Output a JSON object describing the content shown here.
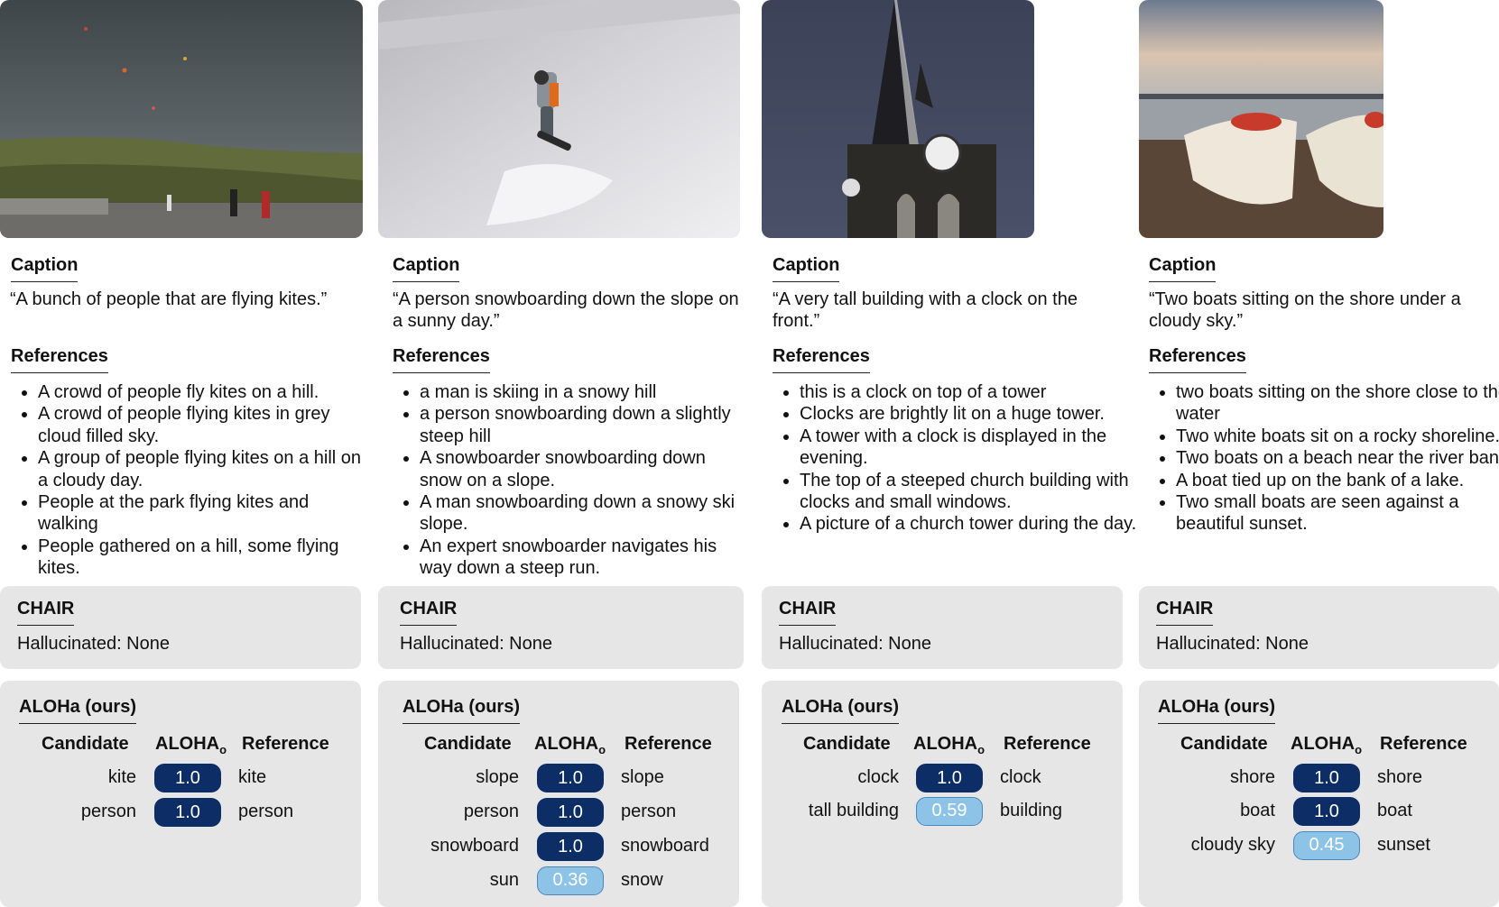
{
  "labels": {
    "caption": "Caption",
    "references": "References",
    "chair": "CHAIR",
    "aloha": "ALOHa (ours)",
    "col_candidate": "Candidate",
    "col_score": "ALOHA",
    "col_score_sub": "o",
    "col_reference": "Reference"
  },
  "colors": {
    "score_high": "#0c2d66",
    "score_low": "#8ec3e8",
    "panel": "#e6e6e6"
  },
  "panels": [
    {
      "image": "kites-on-hill-photo",
      "caption": "“A bunch of people that are flying kites.”",
      "references": [
        "A crowd of people fly kites on a hill.",
        "A crowd of people flying kites in grey cloud filled sky.",
        "A group of people flying kites on a hill on a cloudy day.",
        "People at the park flying kites and walking",
        "People gathered on a hill, some flying kites."
      ],
      "hallucinated": "Hallucinated: None",
      "matches": [
        {
          "candidate": "kite",
          "score": "1.0",
          "reference": "kite"
        },
        {
          "candidate": "person",
          "score": "1.0",
          "reference": "person"
        }
      ]
    },
    {
      "image": "snowboarder-photo",
      "caption": "“A person snowboarding down the slope on a sunny day.”",
      "references": [
        "a man is skiing in a snowy hill",
        "a person snowboarding down a slightly steep hill",
        "A snowboarder snowboarding down snow on a slope.",
        "A man snowboarding down a snowy ski slope.",
        "An expert snowboarder navigates his way down a steep run."
      ],
      "hallucinated": "Hallucinated: None",
      "matches": [
        {
          "candidate": "slope",
          "score": "1.0",
          "reference": "slope"
        },
        {
          "candidate": "person",
          "score": "1.0",
          "reference": "person"
        },
        {
          "candidate": "snowboard",
          "score": "1.0",
          "reference": "snowboard"
        },
        {
          "candidate": "sun",
          "score": "0.36",
          "reference": "snow"
        }
      ]
    },
    {
      "image": "church-clock-tower-photo",
      "caption": "“A very tall building with a clock on the front.”",
      "references": [
        "this is a clock on top of a tower",
        "Clocks are brightly lit on a huge tower.",
        "A tower with a clock is displayed in the evening.",
        "The top of a steeped church building with clocks and small windows.",
        " A picture of a church tower during the day."
      ],
      "hallucinated": "Hallucinated: None",
      "matches": [
        {
          "candidate": "clock",
          "score": "1.0",
          "reference": "clock"
        },
        {
          "candidate": "tall building",
          "score": "0.59",
          "reference": "building"
        }
      ]
    },
    {
      "image": "boats-on-shore-photo",
      "caption": "“Two boats sitting on the shore under a cloudy sky.”",
      "references": [
        "two boats sitting on the shore close to the water",
        "Two white boats sit on a rocky shoreline.",
        "Two boats on a beach near the river bank",
        "A boat tied up on the bank of a lake.",
        "Two small boats are seen against a beautiful sunset."
      ],
      "hallucinated": "Hallucinated: None",
      "matches": [
        {
          "candidate": "shore",
          "score": "1.0",
          "reference": "shore"
        },
        {
          "candidate": "boat",
          "score": "1.0",
          "reference": "boat"
        },
        {
          "candidate": "cloudy sky",
          "score": "0.45",
          "reference": "sunset"
        }
      ]
    }
  ]
}
